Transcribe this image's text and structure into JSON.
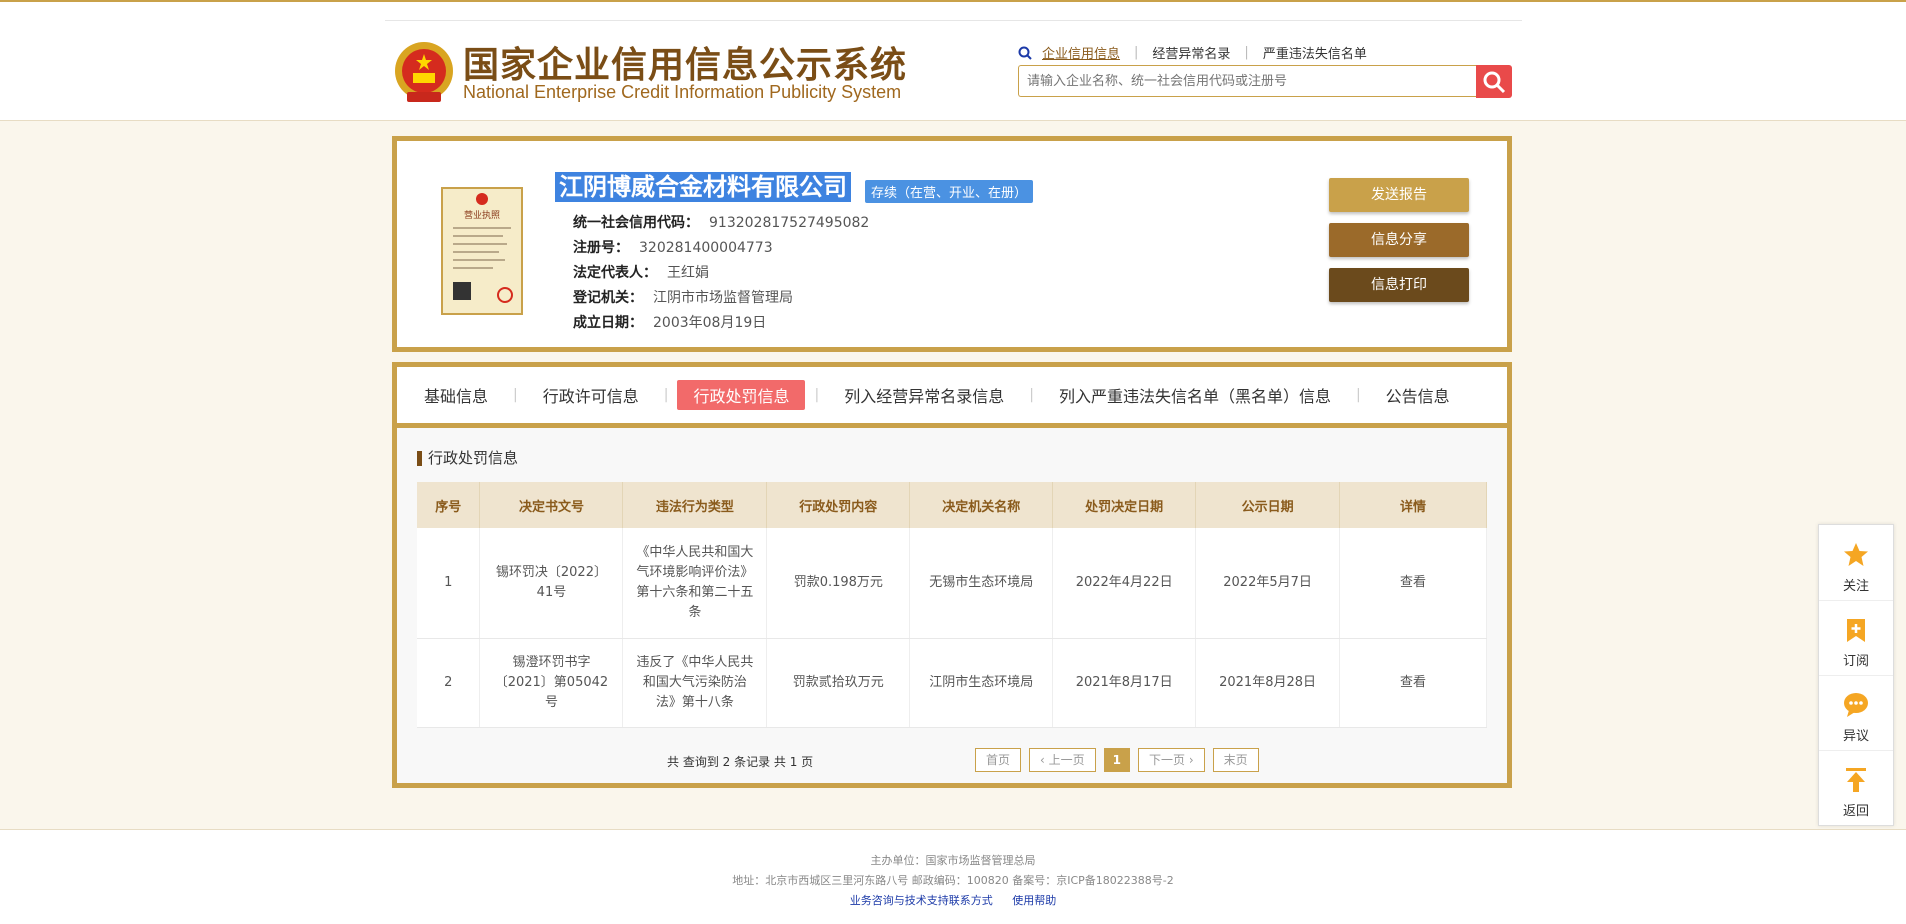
{
  "header": {
    "title_cn": "国家企业信用信息公示系统",
    "title_en": "National Enterprise Credit Information Publicity System",
    "nav": [
      {
        "label": "企业信用信息",
        "active": true
      },
      {
        "label": "经营异常名录",
        "active": false
      },
      {
        "label": "严重违法失信名单",
        "active": false
      }
    ],
    "search": {
      "placeholder": "请输入企业名称、统一社会信用代码或注册号",
      "value": ""
    }
  },
  "company": {
    "name": "江阴博威合金材料有限公司",
    "status": "存续（在营、开业、在册）",
    "fields": [
      {
        "label": "统一社会信用代码：",
        "value": "913202817527495082"
      },
      {
        "label": "注册号：",
        "value": "320281400004773"
      },
      {
        "label": "法定代表人：",
        "value": "王红娟"
      },
      {
        "label": "登记机关：",
        "value": "江阴市市场监督管理局"
      },
      {
        "label": "成立日期：",
        "value": "2003年08月19日"
      }
    ],
    "license_text": "营业执照",
    "actions": [
      "发送报告",
      "信息分享",
      "信息打印"
    ]
  },
  "tabs": [
    {
      "label": "基础信息",
      "active": false
    },
    {
      "label": "行政许可信息",
      "active": false
    },
    {
      "label": "行政处罚信息",
      "active": true
    },
    {
      "label": "列入经营异常名录信息",
      "active": false
    },
    {
      "label": "列入严重违法失信名单（黑名单）信息",
      "active": false
    },
    {
      "label": "公告信息",
      "active": false
    }
  ],
  "section": {
    "title": "行政处罚信息",
    "columns": [
      "序号",
      "决定书文号",
      "违法行为类型",
      "行政处罚内容",
      "决定机关名称",
      "处罚决定日期",
      "公示日期",
      "详情"
    ],
    "rows": [
      [
        "1",
        "锡环罚决〔2022〕41号",
        "《中华人民共和国大气环境影响评价法》第十六条和第二十五条",
        "罚款0.198万元",
        "无锡市生态环境局",
        "2022年4月22日",
        "2022年5月7日",
        "查看"
      ],
      [
        "2",
        "锡澄环罚书字〔2021〕第05042号",
        "违反了《中华人民共和国大气污染防治法》第十八条",
        "罚款贰拾玖万元",
        "江阴市生态环境局",
        "2021年8月17日",
        "2021年8月28日",
        "查看"
      ]
    ],
    "total": "共 查询到 2 条记录 共 1 页",
    "pager": {
      "first": "首页",
      "prev": "上一页",
      "current": "1",
      "next": "下一页",
      "last": "末页"
    }
  },
  "sidebar": [
    "关注",
    "订阅",
    "异议",
    "返回"
  ],
  "footer": {
    "line1": "主办单位：国家市场监督管理总局",
    "line2": "地址：北京市西城区三里河东路八号    邮政编码：100820    备案号：京ICP备18022388号-2",
    "link1": "业务咨询与技术支持联系方式",
    "link2": "使用帮助"
  },
  "colors": {
    "gold": "#c9a14a",
    "brown": "#7a4d16",
    "tab_active": "#f26a6a",
    "status_blue": "#4b92e2",
    "search_red": "#e94a4a"
  }
}
